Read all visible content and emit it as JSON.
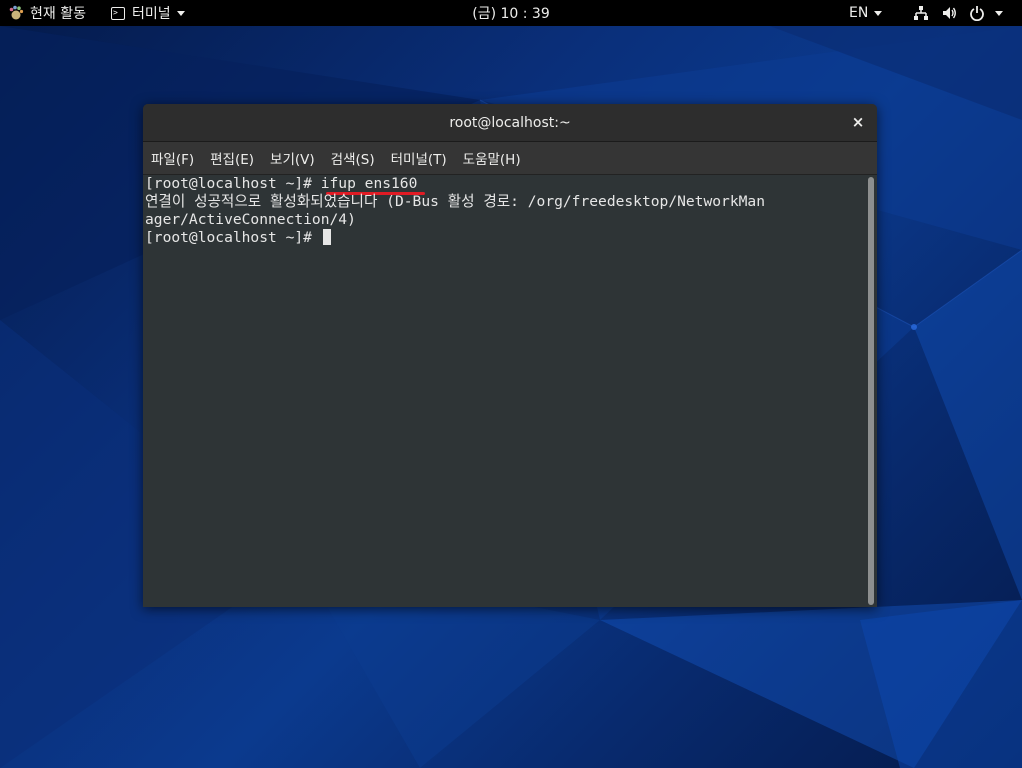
{
  "topbar": {
    "activities_label": "현재 활동",
    "app_menu_label": "터미널",
    "clock": "(금) 10 : 39",
    "language": "EN"
  },
  "window": {
    "title": "root@localhost:~",
    "close_symbol": "×",
    "menu": [
      {
        "label": "파일(F)"
      },
      {
        "label": "편집(E)"
      },
      {
        "label": "보기(V)"
      },
      {
        "label": "검색(S)"
      },
      {
        "label": "터미널(T)"
      },
      {
        "label": "도움말(H)"
      }
    ]
  },
  "terminal": {
    "lines": [
      {
        "prompt": "[root@localhost ~]# ",
        "command": "ifup ens160"
      },
      {
        "text": "연결이 성공적으로 활성화되었습니다 (D-Bus 활성 경로: /org/freedesktop/NetworkMan"
      },
      {
        "text": "ager/ActiveConnection/4)"
      },
      {
        "prompt": "[root@localhost ~]# "
      }
    ]
  },
  "icons": {
    "activities": "gnome-foot-icon",
    "app_menu": "terminal-icon",
    "network": "network-wired-icon",
    "volume": "volume-icon",
    "power": "power-icon"
  },
  "colors": {
    "topbar_bg": "#000000",
    "terminal_bg": "#2e3436",
    "highlight_underline": "#e01b24"
  }
}
